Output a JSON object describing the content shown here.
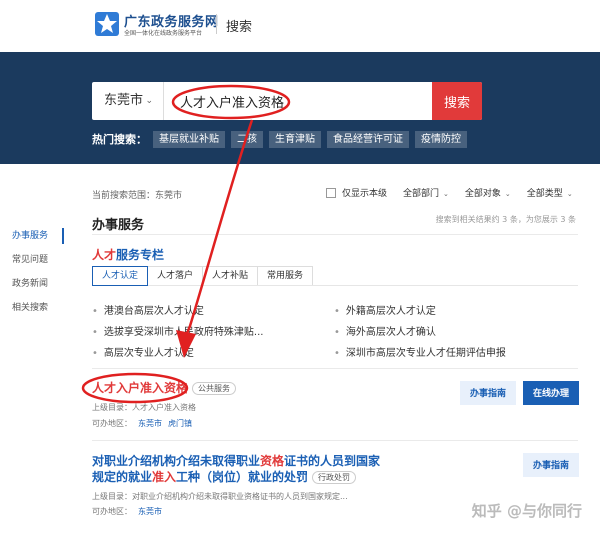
{
  "header": {
    "logo_title": "广东政务服务网",
    "logo_subtitle": "全国一体化在线政务服务平台",
    "page_title": "搜索"
  },
  "search": {
    "city": "东莞市",
    "query": "人才入户准入资格",
    "button_label": "搜索"
  },
  "hot": {
    "label": "热门搜索：",
    "tags": [
      "基层就业补贴",
      "二孩",
      "生育津贴",
      "食品经营许可证",
      "疫情防控"
    ]
  },
  "leftnav": {
    "items": [
      "办事服务",
      "常见问题",
      "政务新闻",
      "相关搜索"
    ]
  },
  "filters": {
    "scope": "当前搜索范围：东莞市",
    "this_level_only": "仅显示本级",
    "dept": "全部部门",
    "target": "全部对象",
    "type": "全部类型"
  },
  "section": {
    "title": "办事服务",
    "count": "搜索到相关结果约 3 条，为您展示 3 条"
  },
  "special": {
    "title_red": "人才",
    "title_blue": "服务专栏",
    "tabs": [
      "人才认定",
      "人才落户",
      "人才补贴",
      "常用服务"
    ],
    "links": [
      "港澳台高层次人才认定",
      "外籍高层次人才认定",
      "选拔享受深圳市人民政府特殊津贴...",
      "海外高层次人才确认",
      "高层次专业人才认定",
      "深圳市高层次专业人才任期评估申报"
    ]
  },
  "results": [
    {
      "title_hl": "人才入户准入资格",
      "badge": "公共服务",
      "parent_label": "上级目录：",
      "parent": "人才入户准入资格",
      "area_label": "可办地区：",
      "area": [
        "东莞市",
        "虎门镇"
      ],
      "guide": "办事指南",
      "online": "在线办理"
    },
    {
      "title_p1": "对职业介绍机构介绍未取得职业",
      "title_hl1": "资格",
      "title_p2": "证书的人员到国家规定的就业",
      "title_hl2": "准入",
      "title_p3": "工种（岗位）就业的处罚",
      "badge": "行政处罚",
      "parent_label": "上级目录：",
      "parent": "对职业介绍机构介绍未取得职业资格证书的人员到国家规定...",
      "area_label": "可办地区：",
      "area": [
        "东莞市"
      ],
      "guide": "办事指南"
    }
  ],
  "watermark": "知乎 @与你同行",
  "colors": {
    "banner": "#1b3a5e",
    "accent_blue": "#1a5fb4",
    "accent_red": "#e13a3a",
    "annotation_red": "#e02020"
  }
}
